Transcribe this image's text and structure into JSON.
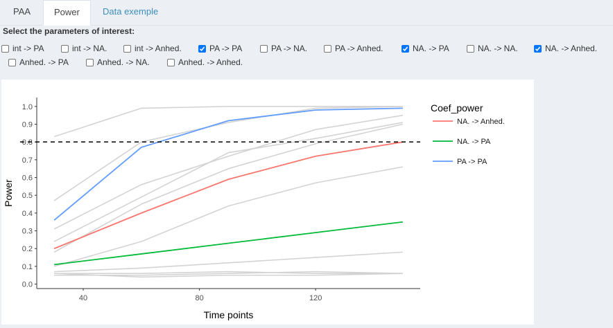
{
  "tabs": [
    {
      "label": "PAA",
      "state": "inactive"
    },
    {
      "label": "Power",
      "state": "active"
    },
    {
      "label": "Data exemple",
      "state": "link"
    }
  ],
  "params": {
    "label": "Select the parameters of interest:",
    "options": [
      {
        "label": "int -> PA",
        "checked": false
      },
      {
        "label": "int -> NA.",
        "checked": false
      },
      {
        "label": "int -> Anhed.",
        "checked": false
      },
      {
        "label": "PA -> PA",
        "checked": true
      },
      {
        "label": "PA -> NA.",
        "checked": false
      },
      {
        "label": "PA -> Anhed.",
        "checked": false
      },
      {
        "label": "NA. -> PA",
        "checked": true
      },
      {
        "label": "NA. -> NA.",
        "checked": false
      },
      {
        "label": "NA. -> Anhed.",
        "checked": true
      },
      {
        "label": "Anhed. -> PA",
        "checked": false
      },
      {
        "label": "Anhed. -> NA.",
        "checked": false
      },
      {
        "label": "Anhed. -> Anhed.",
        "checked": false
      }
    ]
  },
  "chart_data": {
    "type": "line",
    "xlabel": "Time points",
    "ylabel": "Power",
    "xlim": [
      24,
      156
    ],
    "ylim": [
      -0.025,
      1.05
    ],
    "x_ticks": [
      40,
      80,
      120
    ],
    "y_ticks": [
      0.0,
      0.1,
      0.2,
      0.3,
      0.4,
      0.5,
      0.6,
      0.7,
      0.8,
      0.9,
      1.0
    ],
    "y_tick_labels": [
      "0.0",
      "0.1",
      "0.2",
      "0.3",
      "0.4",
      "0.5",
      "0.6",
      "0.7",
      "0.8",
      "0.9",
      "1.0"
    ],
    "x_tick_labels": [
      "40",
      "80",
      "120"
    ],
    "threshold": 0.8,
    "grid": false,
    "legend": {
      "title": "Coef_power",
      "position": "right"
    },
    "x": [
      30,
      60,
      90,
      120,
      150
    ],
    "series": [
      {
        "name": "NA. -> Anhed.",
        "color": "#f8766d",
        "highlighted": true,
        "values": [
          0.2,
          0.4,
          0.59,
          0.72,
          0.8
        ]
      },
      {
        "name": "NA. -> PA",
        "color": "#00ba38",
        "highlighted": true,
        "values": [
          0.11,
          0.17,
          0.23,
          0.29,
          0.35
        ]
      },
      {
        "name": "PA -> PA",
        "color": "#619cff",
        "highlighted": true,
        "values": [
          0.36,
          0.77,
          0.92,
          0.98,
          0.99
        ]
      },
      {
        "color": "#d3d3d3",
        "highlighted": false,
        "values": [
          0.83,
          0.99,
          1.0,
          1.0,
          1.0
        ]
      },
      {
        "color": "#d3d3d3",
        "highlighted": false,
        "values": [
          0.47,
          0.8,
          0.91,
          0.99,
          1.0
        ]
      },
      {
        "color": "#d3d3d3",
        "highlighted": false,
        "values": [
          0.31,
          0.56,
          0.72,
          0.87,
          0.95
        ]
      },
      {
        "color": "#d3d3d3",
        "highlighted": false,
        "values": [
          0.24,
          0.49,
          0.74,
          0.82,
          0.91
        ]
      },
      {
        "color": "#d3d3d3",
        "highlighted": false,
        "values": [
          0.18,
          0.45,
          0.65,
          0.79,
          0.9
        ]
      },
      {
        "color": "#d3d3d3",
        "highlighted": false,
        "values": [
          0.1,
          0.24,
          0.44,
          0.57,
          0.66
        ]
      },
      {
        "color": "#d3d3d3",
        "highlighted": false,
        "values": [
          0.07,
          0.09,
          0.12,
          0.15,
          0.18
        ]
      },
      {
        "color": "#d3d3d3",
        "highlighted": false,
        "values": [
          0.06,
          0.06,
          0.07,
          0.06,
          0.06
        ]
      },
      {
        "color": "#d3d3d3",
        "highlighted": false,
        "values": [
          0.05,
          0.05,
          0.06,
          0.07,
          0.06
        ]
      },
      {
        "color": "#d3d3d3",
        "highlighted": false,
        "values": [
          0.06,
          0.04,
          0.05,
          0.05,
          0.06
        ]
      }
    ]
  }
}
